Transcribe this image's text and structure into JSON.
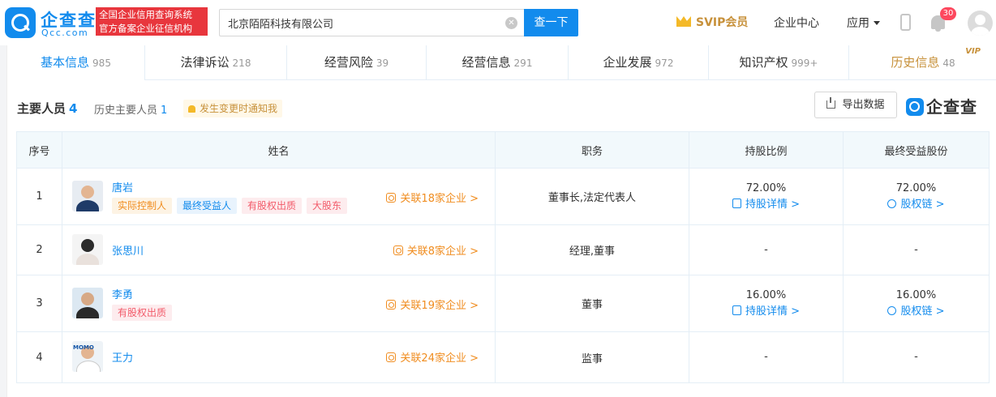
{
  "header": {
    "logo_cn": "企查查",
    "logo_en": "Qcc.com",
    "slogan_line1": "全国企业信用查询系统",
    "slogan_line2": "官方备案企业征信机构",
    "search_value": "北京陌陌科技有限公司",
    "search_button": "查一下",
    "svip_label": "SVIP会员",
    "enterprise_center": "企业中心",
    "apps": "应用",
    "notification_count": "30"
  },
  "tabs": [
    {
      "label": "基本信息",
      "count": "985"
    },
    {
      "label": "法律诉讼",
      "count": "218"
    },
    {
      "label": "经营风险",
      "count": "39"
    },
    {
      "label": "经营信息",
      "count": "291"
    },
    {
      "label": "企业发展",
      "count": "972"
    },
    {
      "label": "知识产权",
      "count": "999+"
    },
    {
      "label": "历史信息",
      "count": "48",
      "badge": "VIP"
    }
  ],
  "section": {
    "title": "主要人员",
    "count": "4",
    "history_label": "历史主要人员",
    "history_count": "1",
    "notify_label": "发生变更时通知我",
    "export_label": "导出数据",
    "watermark": "企查查"
  },
  "table": {
    "headers": {
      "index": "序号",
      "name": "姓名",
      "position": "职务",
      "share_ratio": "持股比例",
      "beneficial": "最终受益股份"
    },
    "rows": [
      {
        "index": "1",
        "name": "唐岩",
        "tags": [
          "实际控制人",
          "最终受益人",
          "有股权出质",
          "大股东"
        ],
        "related": "关联18家企业 >",
        "position": "董事长,法定代表人",
        "share_ratio": "72.00%",
        "share_link": "持股详情 >",
        "beneficial": "72.00%",
        "beneficial_link": "股权链 >"
      },
      {
        "index": "2",
        "name": "张思川",
        "tags": [],
        "related": "关联8家企业 >",
        "position": "经理,董事",
        "share_ratio": "-",
        "beneficial": "-"
      },
      {
        "index": "3",
        "name": "李勇",
        "tags": [
          "有股权出质"
        ],
        "related": "关联19家企业 >",
        "position": "董事",
        "share_ratio": "16.00%",
        "share_link": "持股详情 >",
        "beneficial": "16.00%",
        "beneficial_link": "股权链 >"
      },
      {
        "index": "4",
        "name": "王力",
        "avatar_text": "MOMO",
        "tags": [],
        "related": "关联24家企业 >",
        "position": "监事",
        "share_ratio": "-",
        "beneficial": "-"
      }
    ]
  }
}
